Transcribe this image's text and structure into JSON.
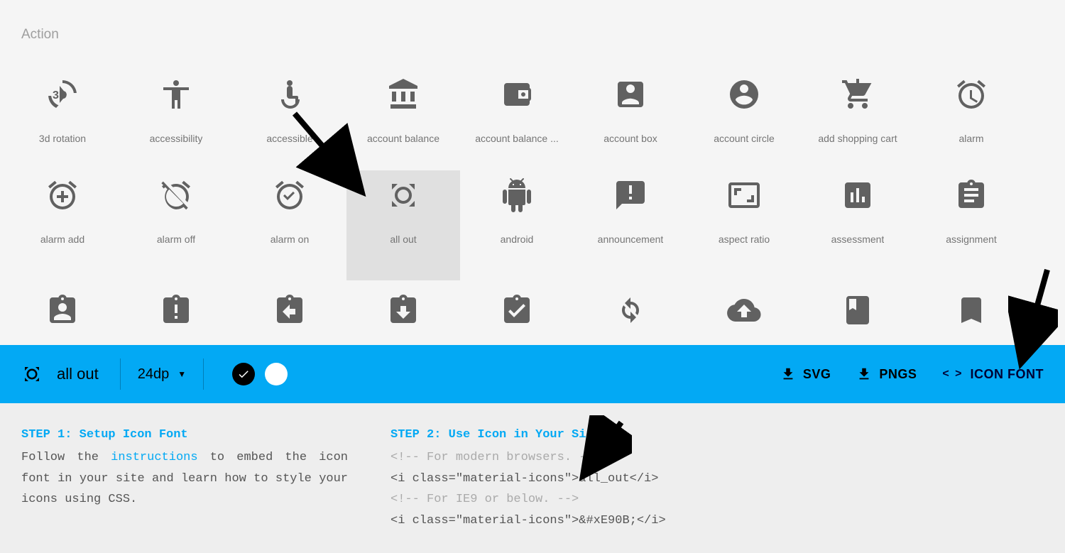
{
  "category": "Action",
  "icons_row1": [
    {
      "label": "3d rotation",
      "name": "3d-rotation-icon"
    },
    {
      "label": "accessibility",
      "name": "accessibility-icon"
    },
    {
      "label": "accessible",
      "name": "accessible-icon"
    },
    {
      "label": "account balance",
      "name": "account-balance-icon"
    },
    {
      "label": "account balance ...",
      "name": "account-balance-wallet-icon"
    },
    {
      "label": "account box",
      "name": "account-box-icon"
    },
    {
      "label": "account circle",
      "name": "account-circle-icon"
    },
    {
      "label": "add shopping cart",
      "name": "add-shopping-cart-icon"
    },
    {
      "label": "alarm",
      "name": "alarm-icon"
    }
  ],
  "icons_row2": [
    {
      "label": "alarm add",
      "name": "alarm-add-icon"
    },
    {
      "label": "alarm off",
      "name": "alarm-off-icon"
    },
    {
      "label": "alarm on",
      "name": "alarm-on-icon"
    },
    {
      "label": "all out",
      "name": "all-out-icon",
      "selected": true
    },
    {
      "label": "android",
      "name": "android-icon"
    },
    {
      "label": "announcement",
      "name": "announcement-icon"
    },
    {
      "label": "aspect ratio",
      "name": "aspect-ratio-icon"
    },
    {
      "label": "assessment",
      "name": "assessment-icon"
    },
    {
      "label": "assignment",
      "name": "assignment-icon"
    }
  ],
  "icons_row3": [
    {
      "label": "assignment ind",
      "name": "assignment-ind-icon"
    },
    {
      "label": "assignment late",
      "name": "assignment-late-icon"
    },
    {
      "label": "assignment return",
      "name": "assignment-return-icon"
    },
    {
      "label": "assignment returned",
      "name": "assignment-returned-icon"
    },
    {
      "label": "assignment turned in",
      "name": "assignment-turned-in-icon"
    },
    {
      "label": "autorenew",
      "name": "autorenew-icon"
    },
    {
      "label": "backup",
      "name": "backup-icon"
    },
    {
      "label": "book",
      "name": "book-icon"
    },
    {
      "label": "bookmark",
      "name": "bookmark-icon"
    }
  ],
  "toolbar": {
    "selected_icon_label": "all out",
    "size_label": "24dp",
    "download_svg": "SVG",
    "download_pngs": "PNGS",
    "icon_font": "ICON FONT"
  },
  "panel": {
    "step1_head": "STEP 1: Setup Icon Font",
    "step1_body_pre": "Follow the ",
    "step1_link": "instructions",
    "step1_body_post": " to embed the icon font in your site and learn how to style your icons using CSS.",
    "step2_head": "STEP 2: Use Icon in Your Site",
    "code_cmt1": "<!-- For modern browsers. -->",
    "code_line1": "<i class=\"material-icons\">all_out</i>",
    "code_cmt2": "<!-- For IE9 or below. -->",
    "code_line2": "<i class=\"material-icons\">&#xE90B;</i>"
  }
}
